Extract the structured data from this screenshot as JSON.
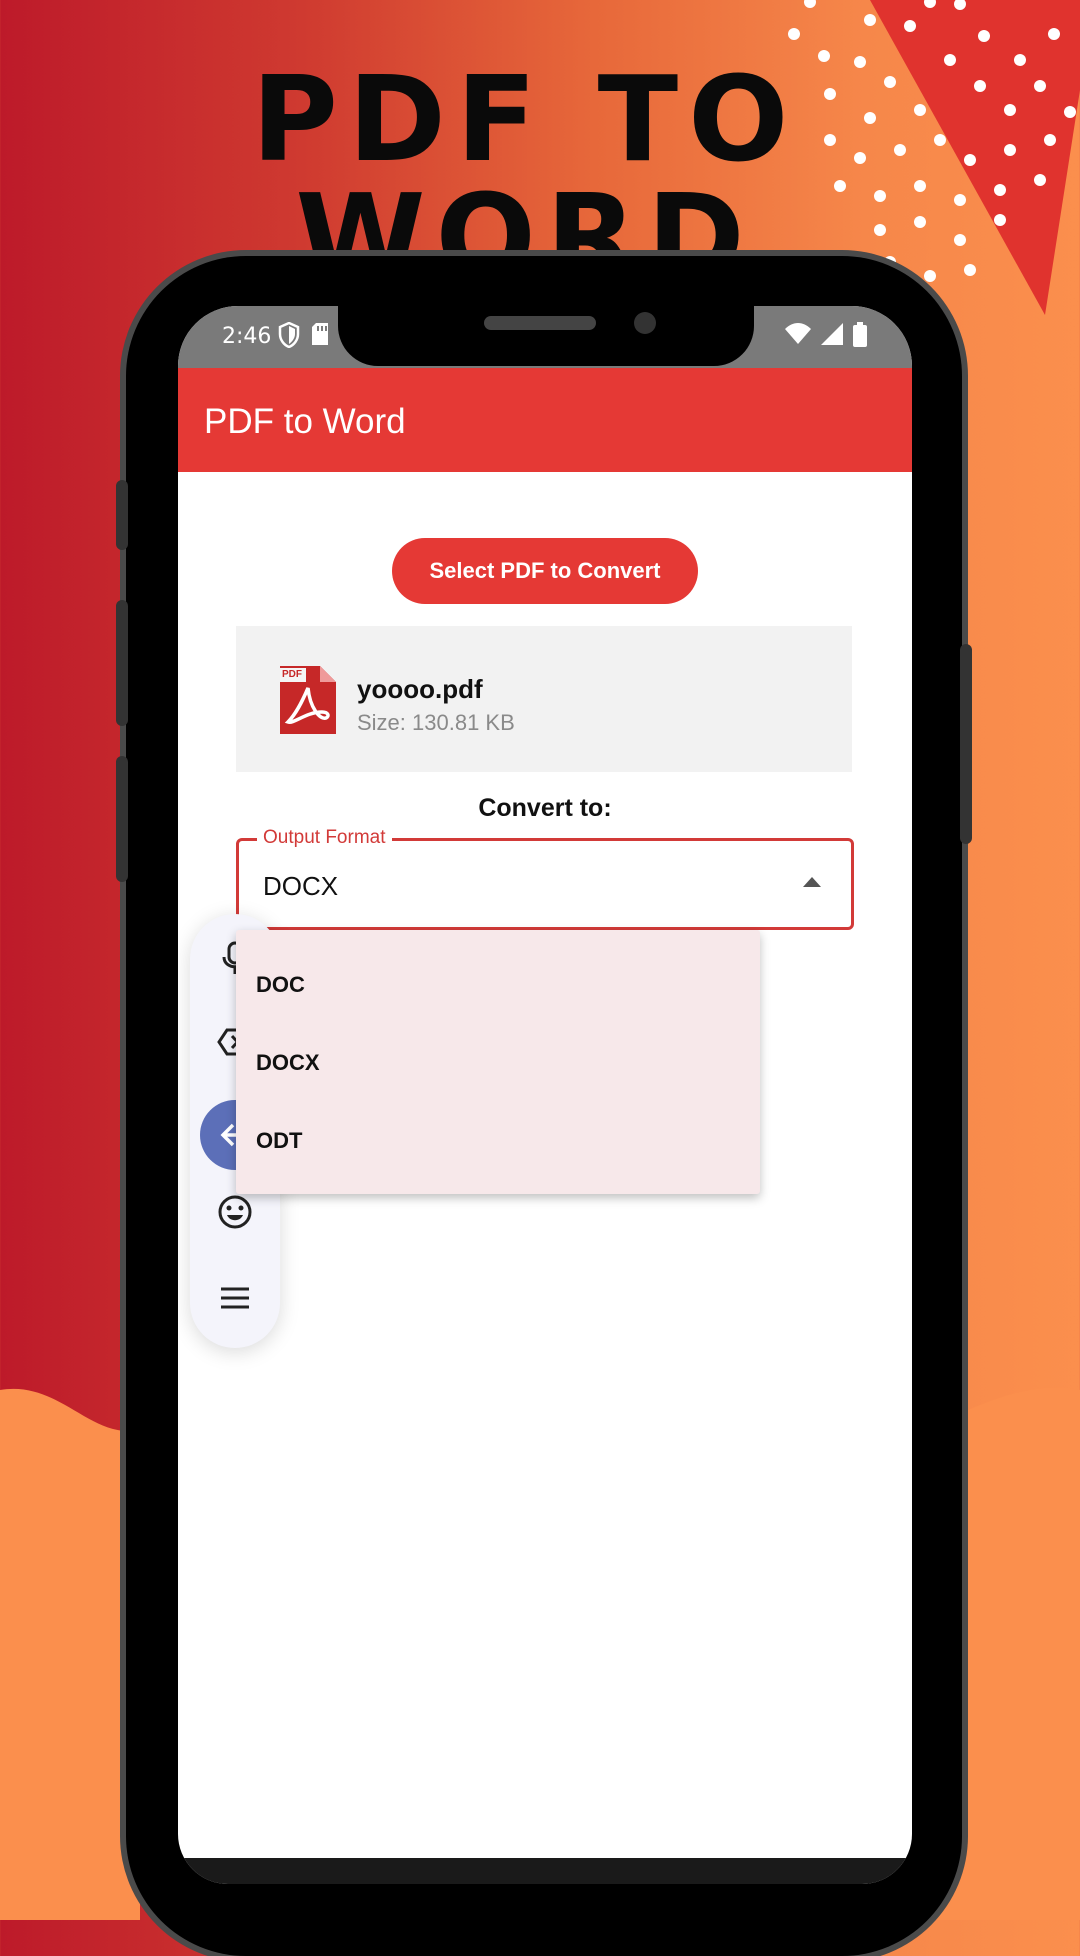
{
  "headline": "PDF TO WORD",
  "status_bar": {
    "time": "2:46",
    "left_icons": [
      "shield-icon",
      "sd-card-icon"
    ],
    "right_icons": [
      "wifi-icon",
      "signal-icon",
      "battery-icon"
    ]
  },
  "app_bar": {
    "title": "PDF to Word"
  },
  "select_button": {
    "label": "Select PDF to Convert"
  },
  "file": {
    "icon": "pdf-file-icon",
    "icon_badge": "PDF",
    "name": "yoooo.pdf",
    "size": "Size: 130.81 KB"
  },
  "convert_label": "Convert to:",
  "output_format": {
    "label": "Output Format",
    "value": "DOCX",
    "options": [
      "DOC",
      "DOCX",
      "ODT"
    ]
  },
  "keyboard_toolbar": {
    "icons": [
      "microphone-icon",
      "clear-icon",
      "back-arrow-icon",
      "emoji-icon",
      "menu-icon"
    ]
  },
  "colors": {
    "primary": "#e53935",
    "status_bar": "#7a7a7a",
    "dropdown_bg": "#f7e8ea",
    "keyboard_accent": "#5c6fb8"
  }
}
